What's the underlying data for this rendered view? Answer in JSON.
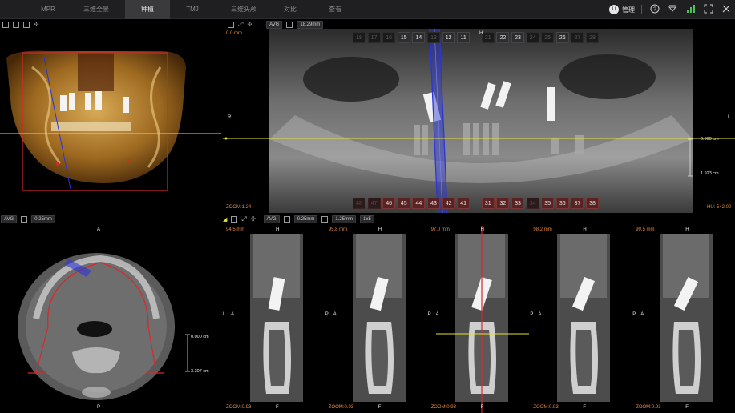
{
  "app": {
    "tabs": [
      {
        "label": "MPR"
      },
      {
        "label": "三维全景"
      },
      {
        "label": "种植",
        "active": true
      },
      {
        "label": "TMJ"
      },
      {
        "label": "三维头颅"
      },
      {
        "label": "对比"
      },
      {
        "label": "查看"
      }
    ],
    "user": {
      "avatar_text": "U",
      "name": "管理"
    },
    "system_icons": [
      "help-icon",
      "download-icon",
      "signal-icon",
      "fullscreen-icon",
      "close-icon"
    ]
  },
  "volume_view": {
    "toolbar_icons": [
      "layout-icon",
      "grid-icon",
      "window-icon",
      "crosshair-icon"
    ]
  },
  "panoramic": {
    "toolbar": {
      "mode": "AVG",
      "thickness": "18.29mm"
    },
    "overlay": {
      "left_top": "0.0 mm",
      "side_left": "R",
      "side_right": "L",
      "zoom": "ZOOM:1.24",
      "hu": "HU: 542.00",
      "scale_top": "0.000 cm",
      "scale_bottom": "1.923 cm"
    },
    "upper_teeth": [
      {
        "n": "18",
        "dim": true
      },
      {
        "n": "17",
        "dim": true
      },
      {
        "n": "16",
        "dim": true
      },
      {
        "n": "15",
        "dim": false
      },
      {
        "n": "14",
        "dim": false
      },
      {
        "n": "13",
        "dim": true
      },
      {
        "n": "12",
        "dim": false
      },
      {
        "n": "11",
        "dim": false
      },
      {
        "n": "21",
        "dim": true
      },
      {
        "n": "22",
        "dim": false
      },
      {
        "n": "23",
        "dim": false
      },
      {
        "n": "24",
        "dim": true
      },
      {
        "n": "25",
        "dim": true
      },
      {
        "n": "26",
        "dim": false
      },
      {
        "n": "27",
        "dim": true
      },
      {
        "n": "28",
        "dim": true
      }
    ],
    "upper_marker": "H",
    "lower_teeth": [
      {
        "n": "48",
        "dim": true
      },
      {
        "n": "47",
        "dim": true
      },
      {
        "n": "46",
        "dim": false
      },
      {
        "n": "45",
        "dim": false
      },
      {
        "n": "44",
        "dim": false
      },
      {
        "n": "43",
        "dim": false
      },
      {
        "n": "42",
        "dim": false
      },
      {
        "n": "41",
        "dim": false
      },
      {
        "n": "31",
        "dim": false
      },
      {
        "n": "32",
        "dim": false
      },
      {
        "n": "33",
        "dim": false
      },
      {
        "n": "34",
        "dim": true
      },
      {
        "n": "35",
        "dim": false
      },
      {
        "n": "36",
        "dim": false
      },
      {
        "n": "37",
        "dim": false
      },
      {
        "n": "38",
        "dim": false
      }
    ]
  },
  "axial": {
    "toolbar": {
      "mode": "AVG",
      "thickness": "0.25mm"
    },
    "overlay": {
      "top": "A",
      "bottom": "P",
      "scale_top": "0.000 cm",
      "scale_bottom": "3.207 cm"
    }
  },
  "cross_sections": {
    "toolbar": {
      "mode": "AVG",
      "thickness": "0.25mm",
      "spacing": "1.25mm",
      "layout": "1x5"
    },
    "slices": [
      {
        "pos": "94.5 mm",
        "zoom": "ZOOM:0.93",
        "h": "H",
        "f": "F",
        "left": "L",
        "right": "A"
      },
      {
        "pos": "95.8 mm",
        "zoom": "ZOOM:0.93",
        "h": "H",
        "f": "F",
        "left": "P",
        "right": "A"
      },
      {
        "pos": "97.0 mm",
        "zoom": "ZOOM:0.93",
        "h": "H",
        "f": "F",
        "left": "P",
        "right": "A"
      },
      {
        "pos": "98.2 mm",
        "zoom": "ZOOM:0.93",
        "h": "H",
        "f": "F",
        "left": "P",
        "right": "A"
      },
      {
        "pos": "99.5 mm",
        "zoom": "ZOOM:0.93",
        "h": "H",
        "f": "F",
        "left": "P",
        "right": "A"
      }
    ]
  },
  "colors": {
    "accent_yellow": "#e5df3a",
    "accent_red": "#d42a2a",
    "accent_blue": "#2a36d8",
    "tab_active": "#3a3a3d"
  }
}
